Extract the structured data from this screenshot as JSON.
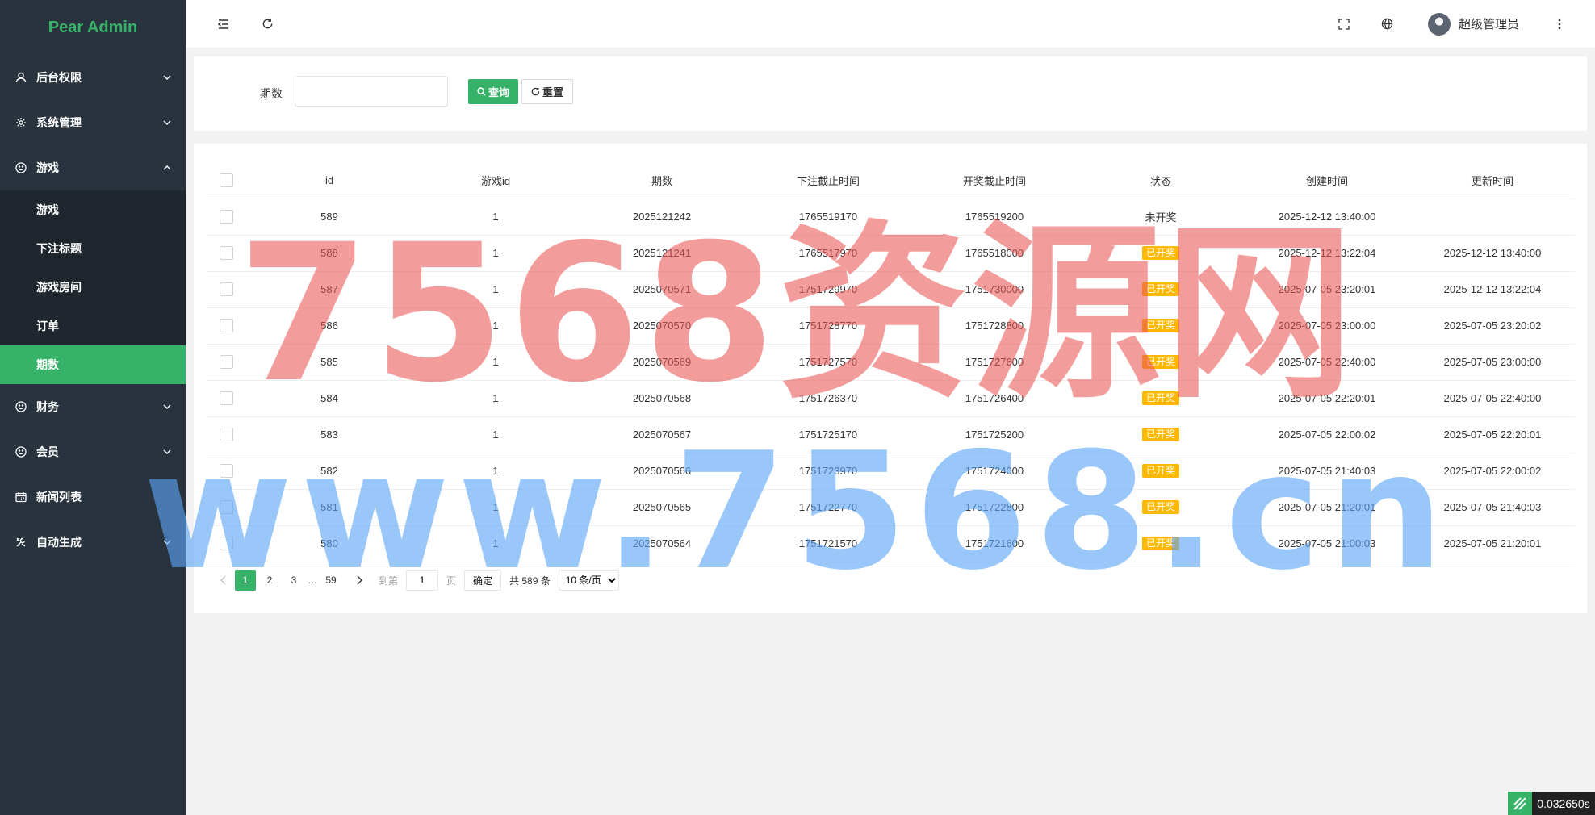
{
  "app": {
    "title": "Pear Admin"
  },
  "sidebar": {
    "items": [
      {
        "label": "后台权限",
        "icon": "user-icon",
        "expandable": true
      },
      {
        "label": "系统管理",
        "icon": "gear-icon",
        "expandable": true
      },
      {
        "label": "游戏",
        "icon": "smile-icon",
        "expanded": true,
        "children": [
          {
            "label": "游戏"
          },
          {
            "label": "下注标题"
          },
          {
            "label": "游戏房间"
          },
          {
            "label": "订单"
          },
          {
            "label": "期数",
            "active": true
          }
        ]
      },
      {
        "label": "财务",
        "icon": "smile-icon",
        "expandable": true
      },
      {
        "label": "会员",
        "icon": "smile-icon",
        "expandable": true
      },
      {
        "label": "新闻列表",
        "icon": "calendar-icon"
      },
      {
        "label": "自动生成",
        "icon": "tools-icon",
        "expandable": true
      }
    ]
  },
  "header": {
    "user_name": "超级管理员"
  },
  "search": {
    "label": "期数",
    "value": "",
    "placeholder": "",
    "query_label": "查询",
    "reset_label": "重置"
  },
  "table": {
    "columns": [
      "id",
      "游戏id",
      "期数",
      "下注截止时间",
      "开奖截止时间",
      "状态",
      "创建时间",
      "更新时间"
    ],
    "rows": [
      {
        "id": "589",
        "game_id": "1",
        "issue": "2025121242",
        "bet_end": "1765519170",
        "draw_end": "1765519200",
        "status": "未开奖",
        "drawn": false,
        "created": "2025-12-12 13:40:00",
        "updated": ""
      },
      {
        "id": "588",
        "game_id": "1",
        "issue": "2025121241",
        "bet_end": "1765517970",
        "draw_end": "1765518000",
        "status": "已开奖",
        "drawn": true,
        "created": "2025-12-12 13:22:04",
        "updated": "2025-12-12 13:40:00"
      },
      {
        "id": "587",
        "game_id": "1",
        "issue": "2025070571",
        "bet_end": "1751729970",
        "draw_end": "1751730000",
        "status": "已开奖",
        "drawn": true,
        "created": "2025-07-05 23:20:01",
        "updated": "2025-12-12 13:22:04"
      },
      {
        "id": "586",
        "game_id": "1",
        "issue": "2025070570",
        "bet_end": "1751728770",
        "draw_end": "1751728800",
        "status": "已开奖",
        "drawn": true,
        "created": "2025-07-05 23:00:00",
        "updated": "2025-07-05 23:20:02"
      },
      {
        "id": "585",
        "game_id": "1",
        "issue": "2025070569",
        "bet_end": "1751727570",
        "draw_end": "1751727600",
        "status": "已开奖",
        "drawn": true,
        "created": "2025-07-05 22:40:00",
        "updated": "2025-07-05 23:00:00"
      },
      {
        "id": "584",
        "game_id": "1",
        "issue": "2025070568",
        "bet_end": "1751726370",
        "draw_end": "1751726400",
        "status": "已开奖",
        "drawn": true,
        "created": "2025-07-05 22:20:01",
        "updated": "2025-07-05 22:40:00"
      },
      {
        "id": "583",
        "game_id": "1",
        "issue": "2025070567",
        "bet_end": "1751725170",
        "draw_end": "1751725200",
        "status": "已开奖",
        "drawn": true,
        "created": "2025-07-05 22:00:02",
        "updated": "2025-07-05 22:20:01"
      },
      {
        "id": "582",
        "game_id": "1",
        "issue": "2025070566",
        "bet_end": "1751723970",
        "draw_end": "1751724000",
        "status": "已开奖",
        "drawn": true,
        "created": "2025-07-05 21:40:03",
        "updated": "2025-07-05 22:00:02"
      },
      {
        "id": "581",
        "game_id": "1",
        "issue": "2025070565",
        "bet_end": "1751722770",
        "draw_end": "1751722800",
        "status": "已开奖",
        "drawn": true,
        "created": "2025-07-05 21:20:01",
        "updated": "2025-07-05 21:40:03"
      },
      {
        "id": "580",
        "game_id": "1",
        "issue": "2025070564",
        "bet_end": "1751721570",
        "draw_end": "1751721600",
        "status": "已开奖",
        "drawn": true,
        "created": "2025-07-05 21:00:03",
        "updated": "2025-07-05 21:20:01"
      }
    ]
  },
  "pagination": {
    "pages": [
      "1",
      "2",
      "3"
    ],
    "current": "1",
    "ellipsis": "…",
    "last_page": "59",
    "goto_label": "到第",
    "goto_value": "1",
    "page_suffix": "页",
    "confirm_label": "确定",
    "total_text": "共 589 条",
    "page_size": "10 条/页"
  },
  "watermark": {
    "line1": "7568资源网",
    "line2": "www.7568.cn"
  },
  "timer": {
    "value": "0.032650s"
  },
  "colors": {
    "accent": "#36b368",
    "sidebar_bg": "#28333e",
    "submenu_bg": "#1f262d",
    "badge": "#ffb800"
  }
}
